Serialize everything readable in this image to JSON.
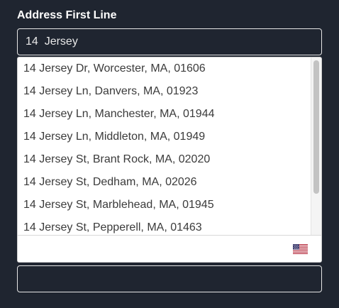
{
  "form": {
    "address_label": "Address First Line",
    "address_value": "14  Jersey",
    "second_field_value": ""
  },
  "autocomplete": {
    "suggestions": [
      "14 Jersey Dr, Worcester, MA, 01606",
      "14 Jersey Ln, Danvers, MA, 01923",
      "14 Jersey Ln, Manchester, MA, 01944",
      "14 Jersey Ln, Middleton, MA, 01949",
      "14 Jersey St, Brant Rock, MA, 02020",
      "14 Jersey St, Dedham, MA, 02026",
      "14 Jersey St, Marblehead, MA, 01945",
      "14 Jersey St, Pepperell, MA, 01463"
    ],
    "country_icon": "us-flag-icon"
  },
  "colors": {
    "page_background": "#1f2530",
    "label_text": "#ffffff",
    "input_border": "#e6e6e6",
    "suggestion_text": "#3b3b3b",
    "flag_red": "#b22234",
    "flag_blue": "#3c3b6e"
  }
}
